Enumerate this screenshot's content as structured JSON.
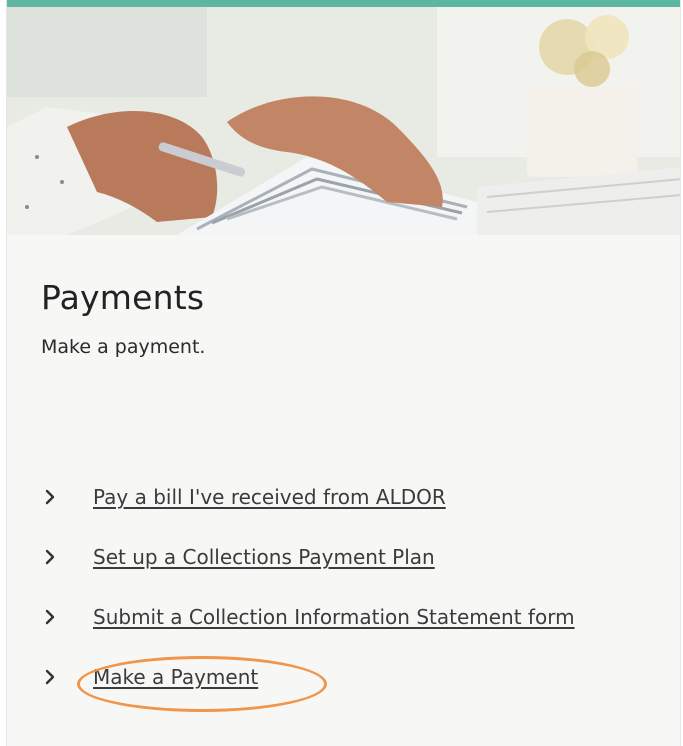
{
  "card": {
    "title": "Payments",
    "subtitle": "Make a payment.",
    "hero_image": "hands-sorting-paper-files-with-pen",
    "accent_color": "#5cb6a0",
    "links": [
      {
        "label": "Pay a bill I've received from ALDOR",
        "icon": "chevron-right-icon"
      },
      {
        "label": "Set up a Collections Payment Plan",
        "icon": "chevron-right-icon"
      },
      {
        "label": "Submit a Collection Information Statement form",
        "icon": "chevron-right-icon"
      },
      {
        "label": "Make a Payment",
        "icon": "chevron-right-icon"
      }
    ]
  },
  "annotation": {
    "highlight_color": "#f0954a",
    "highlighted_link": "Make a Payment"
  }
}
